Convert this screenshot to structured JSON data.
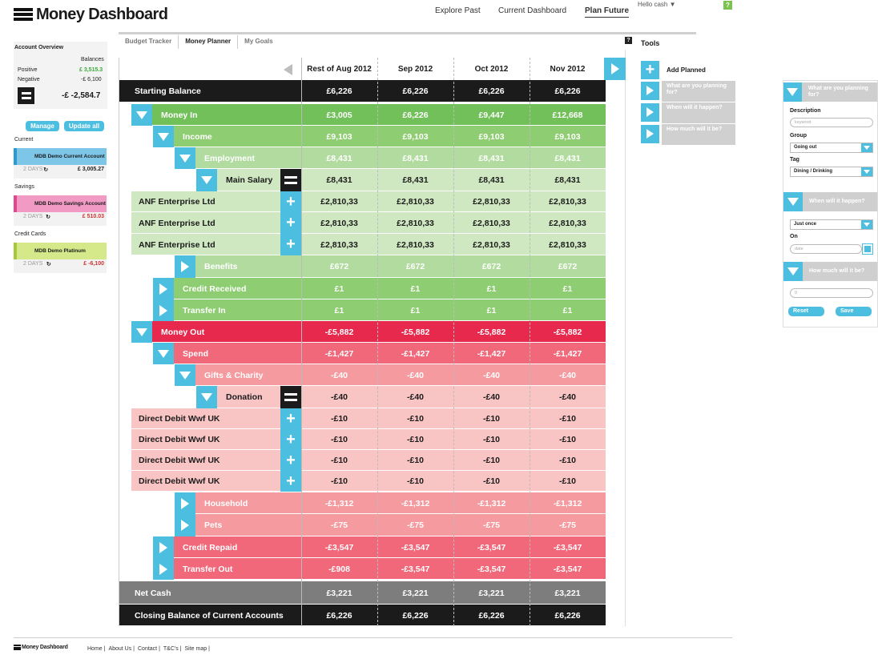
{
  "app": {
    "title": "Money Dashboard"
  },
  "topnav": {
    "explore": "Explore Past",
    "current": "Current Dashboard",
    "plan": "Plan Future",
    "hello": "Hello cash ▼",
    "help": "?"
  },
  "subtabs": [
    "Budget Tracker",
    "Money Planner",
    "My Goals"
  ],
  "tools": {
    "title": "Tools",
    "add_planned": "Add Planned",
    "items": [
      "What are you planning for?",
      "When will it happen?",
      "How much will it be?"
    ]
  },
  "sidebar": {
    "overview_title": "Account Overview",
    "balances_label": "Balances",
    "positive_label": "Positive",
    "positive_value": "£ 3,515.3",
    "negative_label": "Negative",
    "negative_value": "-£ 6,100",
    "total_value": "-£ -2,584.7",
    "manage": "Manage",
    "update_all": "Update all",
    "groups": [
      {
        "title": "Current",
        "account": "MDB Demo Current Account",
        "days": "2 DAYS",
        "amount": "£ 3,005.27",
        "color": "#7ec6e8",
        "stripe": "#2a9bd0"
      },
      {
        "title": "Savings",
        "account": "MDB Demo Savings Account",
        "days": "2 DAYS",
        "amount": "£ 510.03",
        "color": "#f19ac4",
        "stripe": "#e0478f"
      },
      {
        "title": "Credit Cards",
        "account": "MDB Demo Platinum",
        "days": "2 DAYS",
        "amount": "£ -6,100",
        "color": "#d5e88a",
        "stripe": "#a6c83a"
      }
    ]
  },
  "table": {
    "columns": [
      "Rest of Aug 2012",
      "Sep 2012",
      "Oct 2012",
      "Nov 2012"
    ],
    "rows": [
      {
        "label": "Starting Balance",
        "values": [
          "£6,226",
          "£6,226",
          "£6,226",
          "£6,226"
        ]
      },
      {
        "label": "Money In",
        "values": [
          "£3,005",
          "£6,226",
          "£9,447",
          "£12,668"
        ]
      },
      {
        "label": "Income",
        "values": [
          "£9,103",
          "£9,103",
          "£9,103",
          "£9,103"
        ]
      },
      {
        "label": "Employment",
        "values": [
          "£8,431",
          "£8,431",
          "£8,431",
          "£8,431"
        ]
      },
      {
        "label": "Main Salary",
        "values": [
          "£8,431",
          "£8,431",
          "£8,431",
          "£8,431"
        ]
      },
      {
        "label": "ANF Enterprise Ltd",
        "values": [
          "£2,810,33",
          "£2,810,33",
          "£2,810,33",
          "£2,810,33"
        ]
      },
      {
        "label": "ANF Enterprise Ltd",
        "values": [
          "£2,810,33",
          "£2,810,33",
          "£2,810,33",
          "£2,810,33"
        ]
      },
      {
        "label": "ANF Enterprise Ltd",
        "values": [
          "£2,810,33",
          "£2,810,33",
          "£2,810,33",
          "£2,810,33"
        ]
      },
      {
        "label": "Benefits",
        "values": [
          "£672",
          "£672",
          "£672",
          "£672"
        ]
      },
      {
        "label": "Credit Received",
        "values": [
          "£1",
          "£1",
          "£1",
          "£1"
        ]
      },
      {
        "label": "Transfer In",
        "values": [
          "£1",
          "£1",
          "£1",
          "£1"
        ]
      },
      {
        "label": "Money Out",
        "values": [
          "-£5,882",
          "-£5,882",
          "-£5,882",
          "-£5,882"
        ]
      },
      {
        "label": "Spend",
        "values": [
          "-£1,427",
          "-£1,427",
          "-£1,427",
          "-£1,427"
        ]
      },
      {
        "label": "Gifts & Charity",
        "values": [
          "-£40",
          "-£40",
          "-£40",
          "-£40"
        ]
      },
      {
        "label": "Donation",
        "values": [
          "-£40",
          "-£40",
          "-£40",
          "-£40"
        ]
      },
      {
        "label": "Direct Debit Wwf UK",
        "values": [
          "-£10",
          "-£10",
          "-£10",
          "-£10"
        ]
      },
      {
        "label": "Direct Debit Wwf UK",
        "values": [
          "-£10",
          "-£10",
          "-£10",
          "-£10"
        ]
      },
      {
        "label": "Direct Debit Wwf UK",
        "values": [
          "-£10",
          "-£10",
          "-£10",
          "-£10"
        ]
      },
      {
        "label": "Direct Debit Wwf UK",
        "values": [
          "-£10",
          "-£10",
          "-£10",
          "-£10"
        ]
      },
      {
        "label": "Household",
        "values": [
          "-£1,312",
          "-£1,312",
          "-£1,312",
          "-£1,312"
        ]
      },
      {
        "label": "Pets",
        "values": [
          "-£75",
          "-£75",
          "-£75",
          "-£75"
        ]
      },
      {
        "label": "Credit Repaid",
        "values": [
          "-£3,547",
          "-£3,547",
          "-£3,547",
          "-£3,547"
        ]
      },
      {
        "label": "Transfer Out",
        "values": [
          "-£908",
          "-£3,547",
          "-£3,547",
          "-£3,547"
        ]
      },
      {
        "label": "Net Cash",
        "values": [
          "£3,221",
          "£3,221",
          "£3,221",
          "£3,221"
        ]
      },
      {
        "label": "Closing Balance of Current Accounts",
        "values": [
          "£6,226",
          "£6,226",
          "£6,226",
          "£6,226"
        ]
      }
    ]
  },
  "form": {
    "q1": "What are you planning for?",
    "description_label": "Description",
    "description_placeholder": "keyword",
    "group_label": "Group",
    "group_value": "Going out",
    "tag_label": "Tag",
    "tag_value": "Dining / Drinking",
    "q2": "When will it happen?",
    "freq_value": "Just once",
    "on_label": "On",
    "date_placeholder": "date",
    "q3": "How much will it be?",
    "amount_placeholder": "0",
    "reset": "Reset",
    "save": "Save"
  },
  "footer": {
    "logo": "Money Dashboard",
    "links": [
      "Home |",
      "About Us |",
      "Contact |",
      "T&C's |",
      "Site map |"
    ]
  },
  "colors": {
    "accent": "#4cbfe0",
    "dark": "#1b1b1b",
    "green_dark": "#72c05a",
    "red_dark": "#e8294e"
  }
}
